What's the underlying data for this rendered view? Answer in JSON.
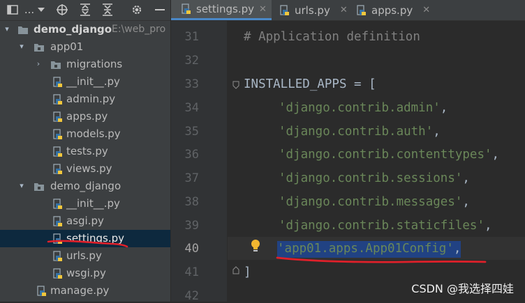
{
  "toolbar": {
    "project_menu_label": "...",
    "icons": [
      "project-window-icon",
      "locate-icon",
      "expand-all-icon",
      "collapse-all-icon",
      "settings-icon"
    ]
  },
  "tree": [
    {
      "label": "demo_django",
      "path": "E:\\web_pro",
      "type": "folder",
      "expanded": true,
      "level": 0
    },
    {
      "label": "app01",
      "type": "folder",
      "expanded": true,
      "level": 1
    },
    {
      "label": "migrations",
      "type": "folder",
      "expanded": false,
      "level": 2
    },
    {
      "label": "__init__.py",
      "type": "python-file",
      "level": 2
    },
    {
      "label": "admin.py",
      "type": "python-file",
      "level": 2
    },
    {
      "label": "apps.py",
      "type": "python-file",
      "level": 2
    },
    {
      "label": "models.py",
      "type": "python-file",
      "level": 2
    },
    {
      "label": "tests.py",
      "type": "python-file",
      "level": 2
    },
    {
      "label": "views.py",
      "type": "python-file",
      "level": 2
    },
    {
      "label": "demo_django",
      "type": "folder",
      "expanded": true,
      "level": 1
    },
    {
      "label": "__init__.py",
      "type": "python-file",
      "level": 2
    },
    {
      "label": "asgi.py",
      "type": "python-file",
      "level": 2
    },
    {
      "label": "settings.py",
      "type": "python-file",
      "level": 2,
      "selected": true
    },
    {
      "label": "urls.py",
      "type": "python-file",
      "level": 2
    },
    {
      "label": "wsgi.py",
      "type": "python-file",
      "level": 2
    },
    {
      "label": "manage.py",
      "type": "python-file",
      "level": 1
    }
  ],
  "tabs": [
    {
      "label": "settings.py",
      "active": true,
      "closable": true
    },
    {
      "label": "urls.py",
      "active": false,
      "closable": true
    },
    {
      "label": "apps.py",
      "active": false,
      "closable": true
    }
  ],
  "editor": {
    "lines": [
      {
        "num": "31",
        "text": "# Application definition",
        "kind": "comment"
      },
      {
        "num": "32",
        "text": "",
        "kind": "blank"
      },
      {
        "num": "33",
        "text": "INSTALLED_APPS = [",
        "kind": "code"
      },
      {
        "num": "34",
        "text": "'django.contrib.admin'",
        "suffix": ",",
        "kind": "string"
      },
      {
        "num": "35",
        "text": "'django.contrib.auth'",
        "suffix": ",",
        "kind": "string"
      },
      {
        "num": "36",
        "text": "'django.contrib.contenttypes'",
        "suffix": ",",
        "kind": "string"
      },
      {
        "num": "37",
        "text": "'django.contrib.sessions'",
        "suffix": ",",
        "kind": "string"
      },
      {
        "num": "38",
        "text": "'django.contrib.messages'",
        "suffix": ",",
        "kind": "string"
      },
      {
        "num": "39",
        "text": "'django.contrib.staticfiles'",
        "suffix": ",",
        "kind": "string"
      },
      {
        "num": "40",
        "text": "'app01.apps.App01Config'",
        "suffix": ",",
        "kind": "selected-string"
      },
      {
        "num": "41",
        "text": "]",
        "kind": "code"
      },
      {
        "num": "42",
        "text": "",
        "kind": "blank"
      }
    ]
  },
  "watermark": "CSDN @我选择四娃",
  "colors": {
    "panel_bg": "#3c3f41",
    "editor_bg": "#2b2b2b",
    "gutter_bg": "#313335",
    "selection_bg": "#214283",
    "tree_selection_bg": "#0d293e",
    "string": "#6a8759",
    "comment": "#808080",
    "annotation_red": "#e0202a"
  }
}
